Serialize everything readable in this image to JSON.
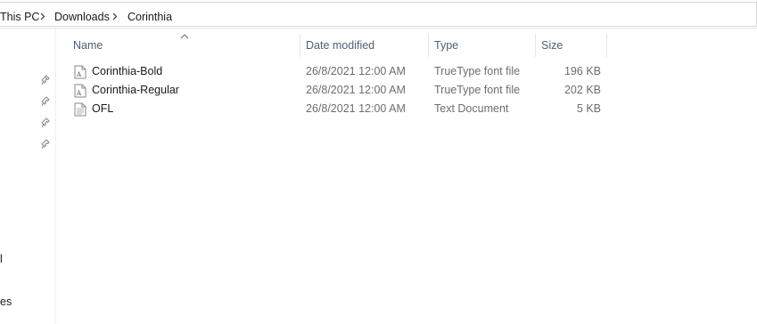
{
  "breadcrumb": {
    "items": [
      "This PC",
      "Downloads",
      "Corinthia"
    ]
  },
  "nav_pane": {
    "fragments": [
      "l",
      "es"
    ],
    "pin_icons": 4
  },
  "columns": {
    "name": "Name",
    "date_modified": "Date modified",
    "type": "Type",
    "size": "Size",
    "sorted_by": "Name"
  },
  "files": [
    {
      "name": "Corinthia-Bold",
      "date": "26/8/2021 12:00 AM",
      "type": "TrueType font file",
      "size": "196 KB",
      "icon": "font-file-icon"
    },
    {
      "name": "Corinthia-Regular",
      "date": "26/8/2021 12:00 AM",
      "type": "TrueType font file",
      "size": "202 KB",
      "icon": "font-file-icon"
    },
    {
      "name": "OFL",
      "date": "26/8/2021 12:00 AM",
      "type": "Text Document",
      "size": "5 KB",
      "icon": "text-file-icon"
    }
  ],
  "colors": {
    "header_text": "#4c607a",
    "secondary_text": "#6d6d6d",
    "divider": "#e5e5e5"
  }
}
